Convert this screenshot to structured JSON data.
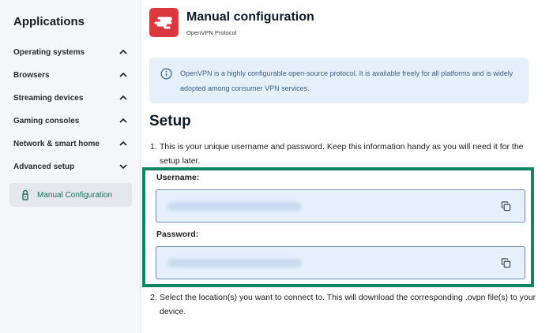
{
  "sidebar": {
    "title": "Applications",
    "items": [
      {
        "label": "Operating systems",
        "state": "expanded"
      },
      {
        "label": "Browsers",
        "state": "expanded"
      },
      {
        "label": "Streaming devices",
        "state": "expanded"
      },
      {
        "label": "Gaming consoles",
        "state": "expanded"
      },
      {
        "label": "Network & smart home",
        "state": "expanded"
      },
      {
        "label": "Advanced setup",
        "state": "collapsed"
      }
    ],
    "active_sub_item": {
      "label": "Manual Configuration",
      "icon": "lock-icon"
    }
  },
  "header": {
    "title": "Manual configuration",
    "subtitle": "OpenVPN Protocol",
    "logo_icon": "expressvpn-logo"
  },
  "info": {
    "icon": "info-icon",
    "text": "OpenVPN is a highly configurable open-source protocol. It is available freely for all platforms and is widely adopted among consumer VPN services."
  },
  "setup": {
    "heading": "Setup",
    "steps": [
      {
        "number": "1.",
        "text": "This is your unique username and password. Keep this information handy as you will need it for the setup later."
      },
      {
        "number": "2.",
        "text": "Select the location(s) you want to connect to. This will download the corresponding .ovpn file(s) to your device."
      }
    ],
    "username_label": "Username:",
    "password_label": "Password:",
    "copy_icon": "copy-icon"
  },
  "colors": {
    "accent_green": "#0e8565",
    "brand_red": "#da3940",
    "info_bg": "#e6f0fb",
    "field_bg": "#e7f0fc"
  }
}
